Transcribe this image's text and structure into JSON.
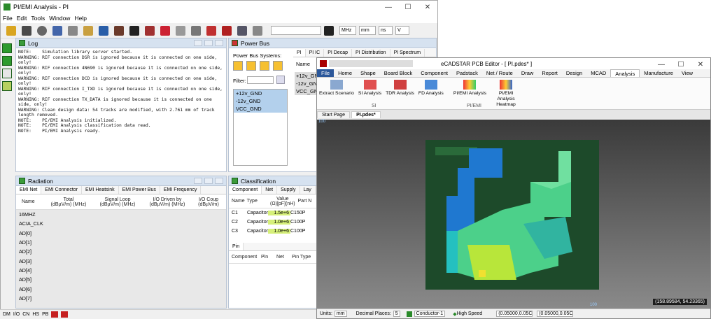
{
  "main_window": {
    "title": "PI/EMI Analysis - PI",
    "menu": [
      "File",
      "Edit",
      "Tools",
      "Window",
      "Help"
    ],
    "unit_selects": [
      "MHz",
      "mm",
      "ns",
      "V"
    ],
    "status_items": [
      "DM",
      "I/O",
      "CN",
      "HS",
      "PB"
    ]
  },
  "log": {
    "title": "Log",
    "lines": "NOTE:    Simulation library server started.\nWARNING: RIF connection DSR is ignored because it is connected on one side, only!\nWARNING: RIF connection 4N690 is ignored because it is connected on one side, only!\nWARNING: RIF connection DCD is ignored because it is connected on one side, only!\nWARNING: RIF connection I_TXD is ignored because it is connected on one side, only!\nWARNING: RIF connection TX_DATA is ignored because it is connected on one side, only!\nWARNING: Clean design data: 54 tracks are modified, with 2.761 mm of track length removed.\nNOTE:    PI/EMI Analysis initialized.\nNOTE:    PI/EMI Analysis classification data read.\nNOTE:    PI/EMI Analysis ready."
  },
  "power_bus": {
    "title": "Power Bus",
    "systems_label": "Power Bus Systems:",
    "filter_label": "Filter:",
    "items": [
      "+12v_GND",
      "-12v_GND",
      "VCC_GND"
    ],
    "tabs": [
      "PI",
      "PI IC",
      "PI Decap",
      "PI Distribution",
      "PI Spectrum"
    ],
    "col_name": "Name",
    "right_list": [
      "+12v_GN",
      "-12v_GN",
      "VCC_GN"
    ]
  },
  "radiation": {
    "title": "Radiation",
    "tabs": [
      "EMI Net",
      "EMI Connector",
      "EMI Heatsink",
      "EMI Power Bus",
      "EMI Frequency"
    ],
    "columns": [
      "Name",
      "Total\n(dBµV/m) (MHz)",
      "Signal Loop\n(dBµV/m) (MHz)",
      "I/O Driven by\n(dBµV/m) (MHz)",
      "I/O Coup\n(dBµV/m)"
    ],
    "rows": [
      "16MHZ",
      "ACIA_CLK",
      "AD[0]",
      "AD[1]",
      "AD[2]",
      "AD[3]",
      "AD[4]",
      "AD[5]",
      "AD[6]",
      "AD[7]"
    ]
  },
  "classification": {
    "title": "Classification",
    "tabs": [
      "Component",
      "Net",
      "Supply",
      "Lay"
    ],
    "columns": [
      "Name",
      "Type",
      "Value\n(Ω)[pF](nH)",
      "Part N"
    ],
    "rows": [
      {
        "name": "C1",
        "type": "Capacitor",
        "value": "1.5e+6",
        "part": "C150P"
      },
      {
        "name": "C2",
        "type": "Capacitor",
        "value": "1.0e+6",
        "part": "C100P"
      },
      {
        "name": "C3",
        "type": "Capacitor",
        "value": "1.0e+6",
        "part": "C100P"
      }
    ],
    "pin_tab": "Pin",
    "pin_columns": [
      "Component",
      "Pin",
      "Net",
      "Pin Type"
    ]
  },
  "pcb_window": {
    "title": "eCADSTAR PCB Editor - [ PI.pdes* ]",
    "menu": [
      "File",
      "Home",
      "Shape",
      "Board Block",
      "Component",
      "Padstack",
      "Net / Route",
      "Draw",
      "Report",
      "Design",
      "MCAD",
      "Analysis",
      "Manufacture",
      "View"
    ],
    "si_group": [
      {
        "label": "Extract Scenario"
      },
      {
        "label": "SI Analysis"
      },
      {
        "label": "TDR Analysis"
      },
      {
        "label": "FD Analysis"
      }
    ],
    "si_group_label": "SI",
    "piemi_group": [
      {
        "label": "PI/EMI Analysis"
      },
      {
        "label": "PI/EMI Analysis Heatmap"
      }
    ],
    "piemi_group_label": "PI/EMI",
    "doc_tabs": [
      "Start Page",
      "PI.pdes*"
    ],
    "ruler_top": "100",
    "ruler_bottom": "100",
    "coordinates": "(158.89584, 54.23365)",
    "status": {
      "units_label": "Units:",
      "units": "mm",
      "decimal_label": "Decimal Places:",
      "decimal": "5",
      "conductor": "Conductor-1",
      "high_speed": "High Speed",
      "coord1": "(0.05000,0.05C",
      "coord2": "(0.05000,0.05C"
    }
  }
}
